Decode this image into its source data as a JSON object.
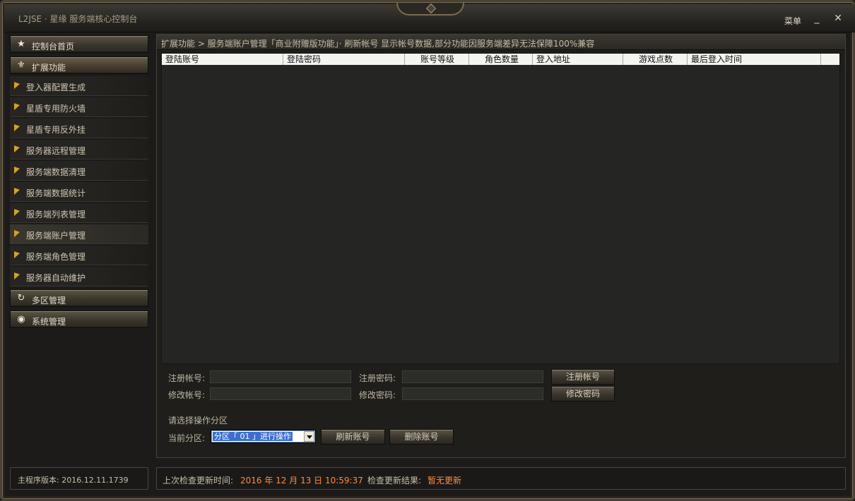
{
  "window": {
    "title": "L2JSE · 星缘 服务端核心控制台",
    "menu_label": "菜单",
    "minimize_label": "_",
    "close_label": "✕"
  },
  "sidebar": {
    "sections": [
      {
        "label": "控制台首页",
        "icon": "star-icon"
      },
      {
        "label": "扩展功能",
        "icon": "fleur-icon"
      },
      {
        "label": "多区管理",
        "icon": "refresh-icon"
      },
      {
        "label": "系统管理",
        "icon": "eye-icon"
      }
    ],
    "items": [
      {
        "label": "登入器配置生成"
      },
      {
        "label": "星盾专用防火墙"
      },
      {
        "label": "星盾专用反外挂"
      },
      {
        "label": "服务器远程管理"
      },
      {
        "label": "服务端数据清理"
      },
      {
        "label": "服务端数据统计"
      },
      {
        "label": "服务端列表管理"
      },
      {
        "label": "服务端账户管理"
      },
      {
        "label": "服务端角色管理"
      },
      {
        "label": "服务器自动维护"
      }
    ],
    "version_text": "主程序版本: 2016.12.11.1739"
  },
  "breadcrumb": {
    "text": "扩展功能 > 服务端账户管理「商业附赠版功能」· 刷新帐号 显示帐号数据,部分功能因服务端差异无法保障100%兼容"
  },
  "table": {
    "columns": [
      "登陆账号",
      "登陆密码",
      "账号等级",
      "角色数量",
      "登入地址",
      "游戏点数",
      "最后登入时间"
    ]
  },
  "form": {
    "register_account_label": "注册帐号:",
    "register_password_label": "注册密码:",
    "register_button": "注册帐号",
    "modify_account_label": "修改帐号:",
    "modify_password_label": "修改密码:",
    "modify_button": "修改密码",
    "zone_prompt": "请选择操作分区",
    "current_zone_label": "当前分区:",
    "zone_selected": "分区「 01 」进行操作",
    "refresh_button": "刷新账号",
    "delete_button": "删除账号"
  },
  "status": {
    "last_check_label": "上次检查更新时间:",
    "last_check_value": "2016 年 12 月 13 日 10:59:37",
    "result_label": "检查更新结果:",
    "result_value": "暂无更新"
  },
  "colors": {
    "accent_orange": "#ff8c3d",
    "arrow_gold": "#d7a02e",
    "selection_blue": "#3b6fce"
  }
}
